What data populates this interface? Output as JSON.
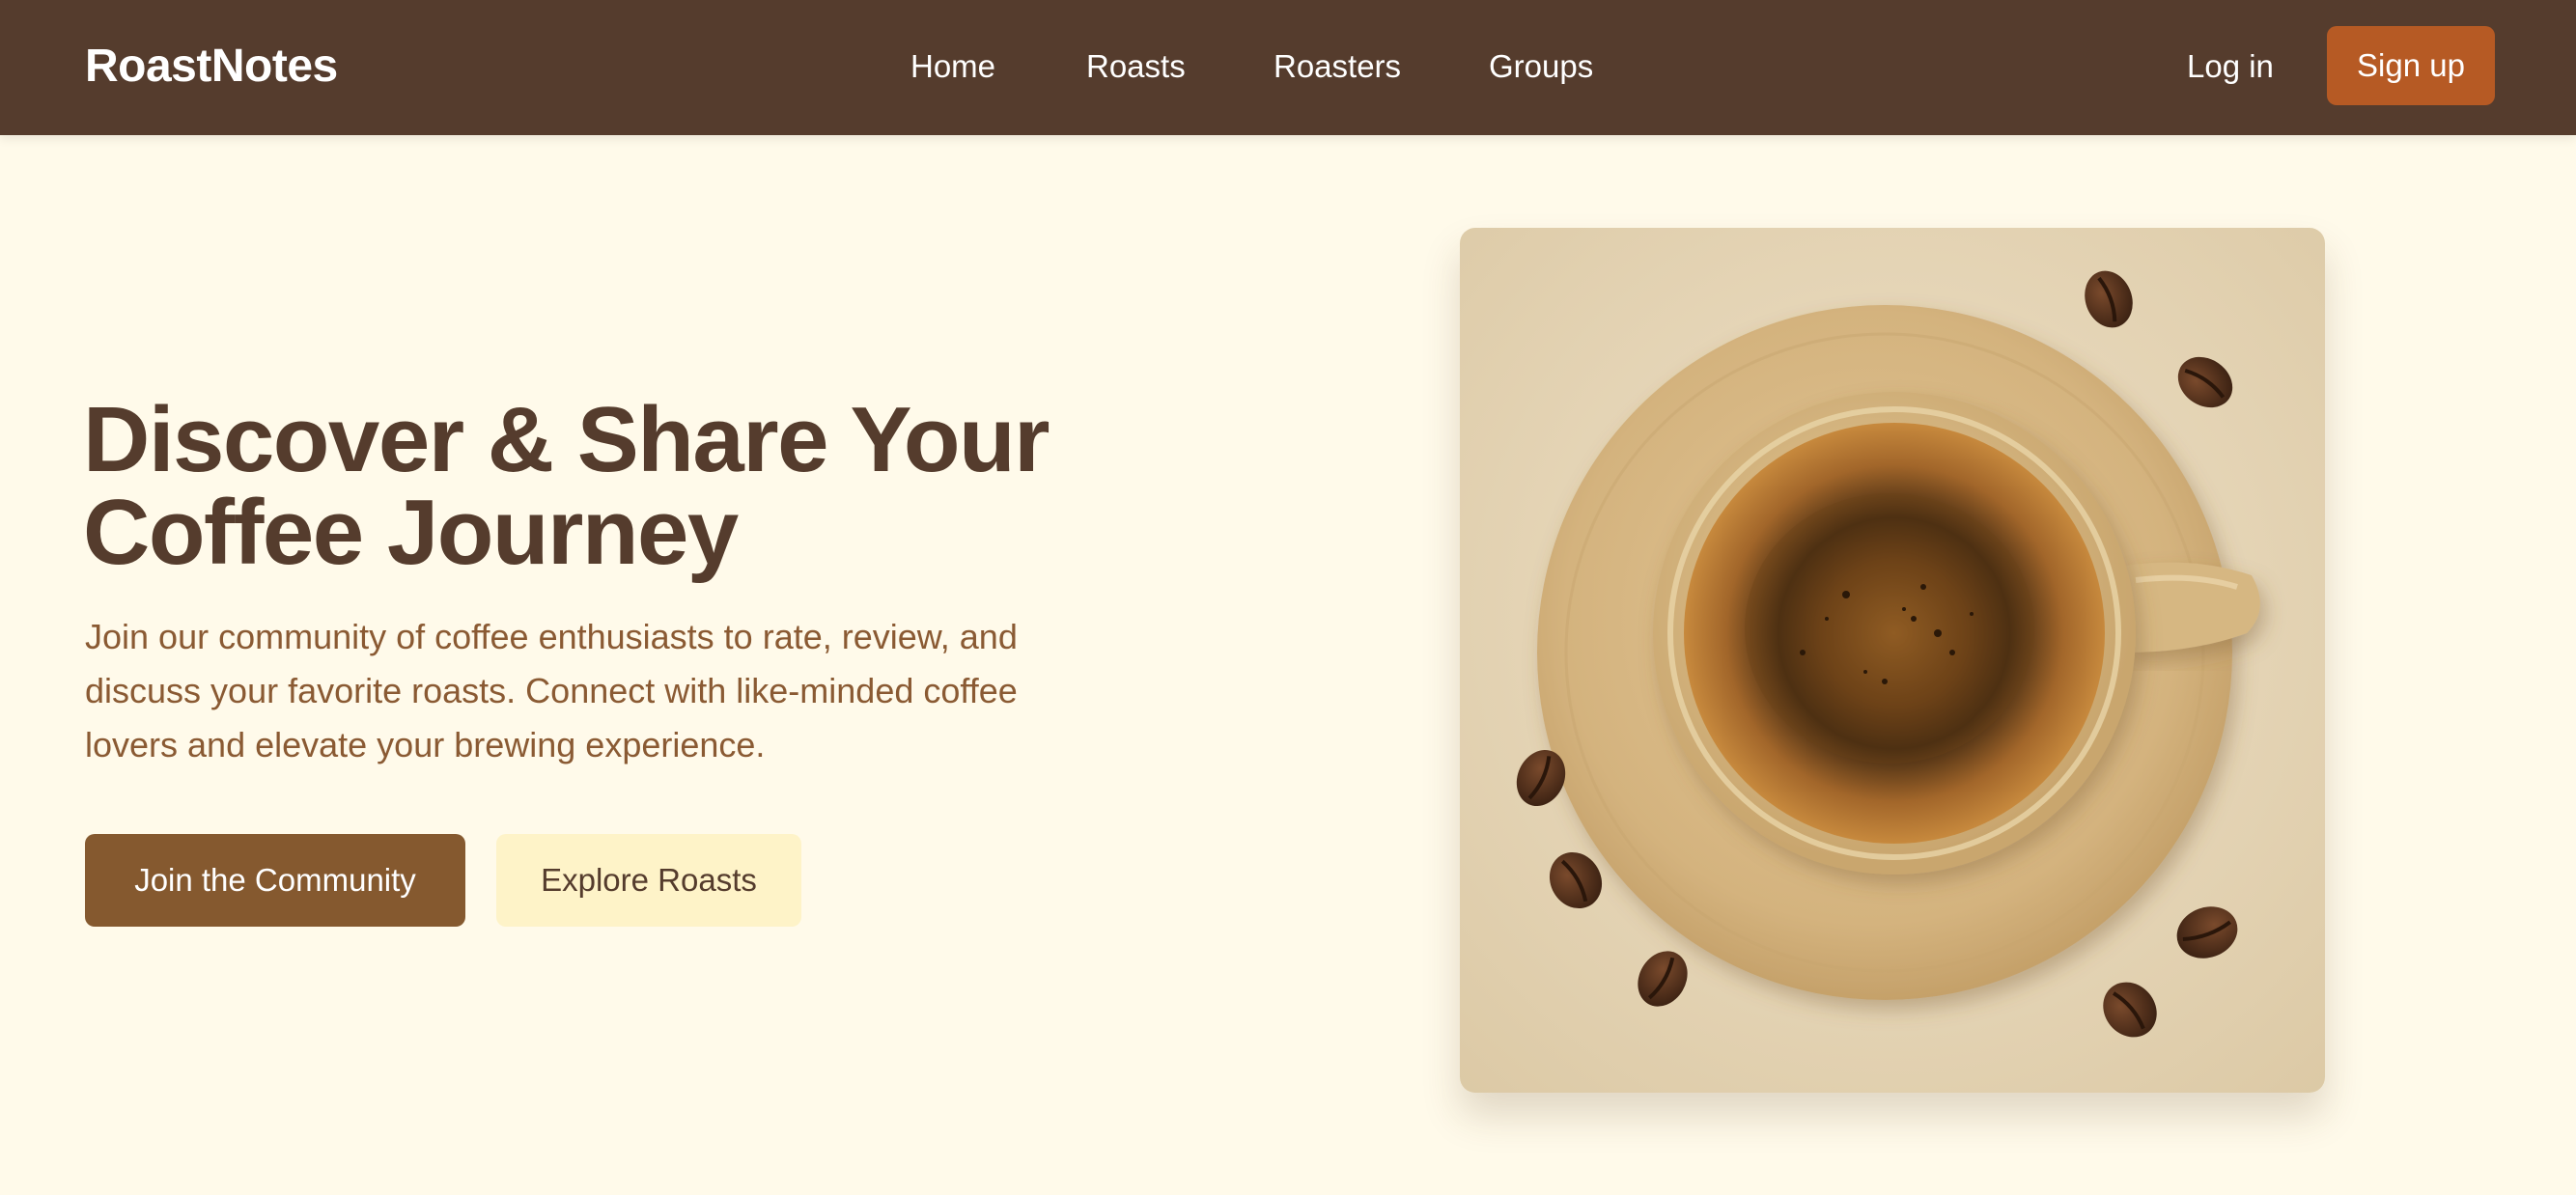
{
  "header": {
    "brand": "RoastNotes",
    "nav": [
      {
        "label": "Home"
      },
      {
        "label": "Roasts"
      },
      {
        "label": "Roasters"
      },
      {
        "label": "Groups"
      }
    ],
    "login_label": "Log in",
    "signup_label": "Sign up"
  },
  "hero": {
    "title_line1": "Discover & Share Your",
    "title_line2": "Coffee Journey",
    "subtitle": "Join our community of coffee enthusiasts to rate, review, and discuss your favorite roasts. Connect with like-minded coffee lovers and elevate your brewing experience.",
    "primary_cta": "Join the Community",
    "secondary_cta": "Explore Roasts"
  },
  "colors": {
    "header_bg": "#553c2d",
    "page_bg": "#fffaea",
    "accent": "#b65a24",
    "primary_button": "#85592f",
    "secondary_button": "#fef3c8"
  }
}
